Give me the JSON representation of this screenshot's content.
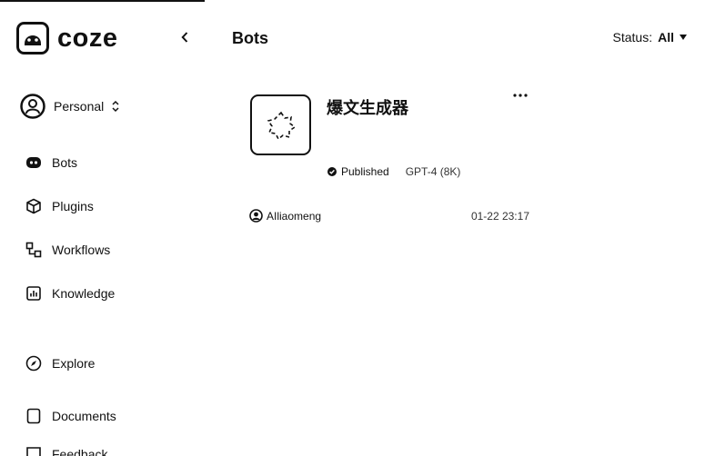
{
  "app": {
    "name": "coze"
  },
  "sidebar": {
    "workspace": {
      "label": "Personal"
    },
    "items": [
      {
        "label": "Bots",
        "icon": "bots-icon"
      },
      {
        "label": "Plugins",
        "icon": "plugins-icon"
      },
      {
        "label": "Workflows",
        "icon": "workflows-icon"
      },
      {
        "label": "Knowledge",
        "icon": "knowledge-icon"
      },
      {
        "label": "Explore",
        "icon": "explore-icon"
      },
      {
        "label": "Documents",
        "icon": "documents-icon"
      },
      {
        "label": "Feedback",
        "icon": "feedback-icon"
      }
    ]
  },
  "header": {
    "title": "Bots",
    "status_label": "Status:",
    "status_value": "All"
  },
  "bots": [
    {
      "name": "爆文生成器",
      "status": "Published",
      "model": "GPT-4 (8K)",
      "creator": "AIliaomeng",
      "updated": "01-22 23:17"
    }
  ]
}
